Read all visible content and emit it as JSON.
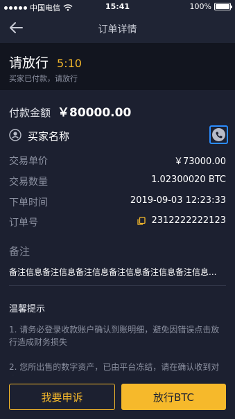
{
  "status_bar": {
    "carrier": "中国电信",
    "time": "15:41",
    "battery": "100%",
    "battery_level": 1.0
  },
  "nav": {
    "title": "订单详情",
    "back_icon": "arrow-left-icon"
  },
  "order_status": {
    "title": "请放行",
    "countdown": "5:10",
    "subtitle": "买家已付款，请放行"
  },
  "payment": {
    "label": "付款金额",
    "amount": "￥80000.00"
  },
  "buyer": {
    "name": "买家名称",
    "user_icon": "user-circle-icon",
    "phone_icon": "phone-icon"
  },
  "details": [
    {
      "label": "交易单价",
      "value": "￥73000.00"
    },
    {
      "label": "交易数量",
      "value": "1.02300020 BTC"
    },
    {
      "label": "下单时间",
      "value": "2019-09-03 12:23:33"
    },
    {
      "label": "订单号",
      "value": "2312222222123"
    }
  ],
  "remark": {
    "title": "备注",
    "text": "备注信息备注信息备注信息备注信息备注信息备注信息..."
  },
  "tips": {
    "title": "温馨提示",
    "items": [
      "1. 请务必登录收款账户确认到账明细，避免因错误点击放行造成财务损失",
      "2. 您所出售的数字资产，已由平台冻结，请在确认收到对方"
    ]
  },
  "actions": {
    "complain_label": "我要申诉",
    "release_label": "放行BTC"
  },
  "colors": {
    "accent": "#f6b92b",
    "background": "#1c2030",
    "header_dark": "#12151f",
    "highlight_border": "#2b8cff"
  }
}
